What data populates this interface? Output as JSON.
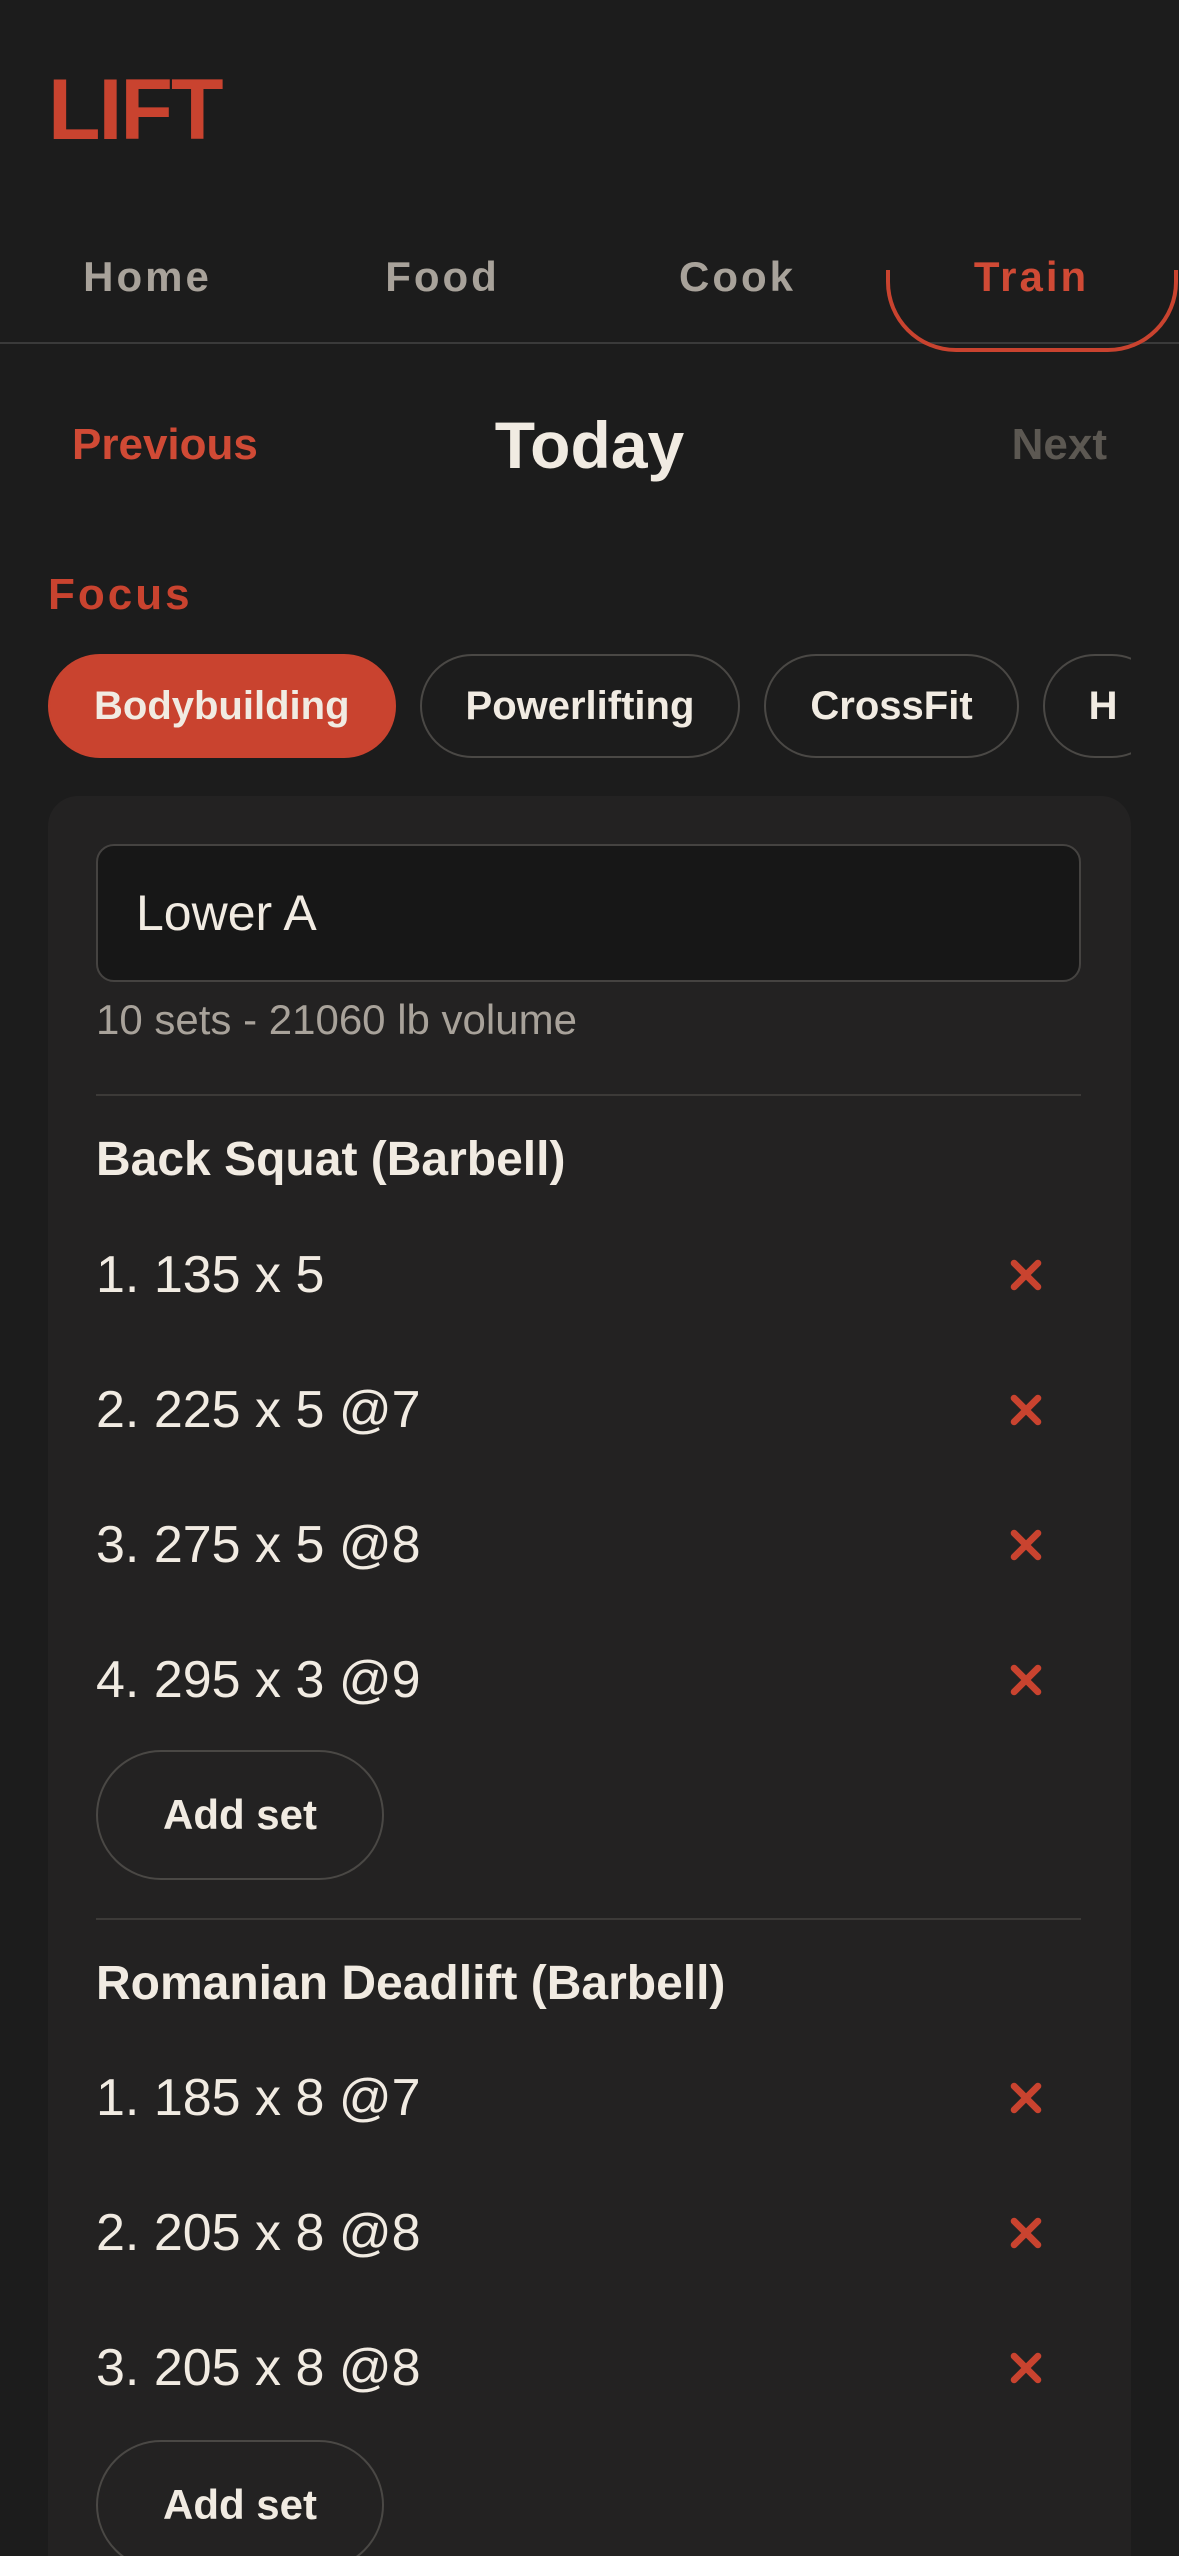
{
  "app": {
    "logo": "LIFT"
  },
  "tabs": [
    {
      "label": "Home",
      "active": false
    },
    {
      "label": "Food",
      "active": false
    },
    {
      "label": "Cook",
      "active": false
    },
    {
      "label": "Train",
      "active": true
    }
  ],
  "day_nav": {
    "previous": "Previous",
    "title": "Today",
    "next": "Next"
  },
  "focus": {
    "label": "Focus",
    "options": [
      {
        "label": "Bodybuilding",
        "selected": true
      },
      {
        "label": "Powerlifting",
        "selected": false
      },
      {
        "label": "CrossFit",
        "selected": false
      },
      {
        "label": "H",
        "selected": false
      }
    ]
  },
  "workout": {
    "name": "Lower A",
    "summary": "10 sets - 21060 lb volume",
    "exercises": [
      {
        "title": "Back Squat (Barbell)",
        "sets": [
          "1. 135 x 5",
          "2. 225 x 5 @7",
          "3. 275 x 5 @8",
          "4. 295 x 3 @9"
        ],
        "add_label": "Add set"
      },
      {
        "title": "Romanian Deadlift (Barbell)",
        "sets": [
          "1. 185 x 8 @7",
          "2. 205 x 8 @8",
          "3. 205 x 8 @8"
        ],
        "add_label": "Add set"
      }
    ]
  },
  "colors": {
    "accent": "#c9432f",
    "background": "#1c1c1c",
    "card": "#232222",
    "text": "#f1ebe2",
    "muted": "#a8a29a"
  }
}
